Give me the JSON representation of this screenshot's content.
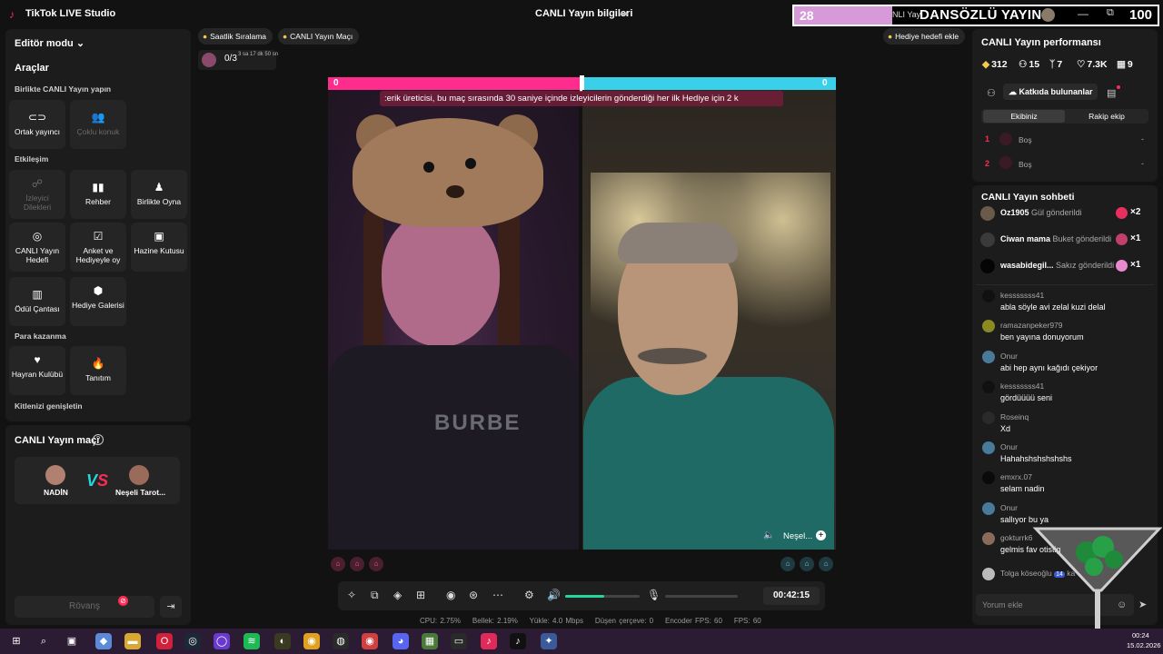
{
  "app": {
    "title": "TikTok LIVE Studio",
    "live_info": "CANLI Yayın bilgileri"
  },
  "overlay": {
    "left_count": "28",
    "middle_text": "NLI Yay",
    "title": "DANSÖZLÜ YAYIN",
    "right_count": "100"
  },
  "window_controls": {
    "minimize": "—",
    "maximize": "⧉"
  },
  "left_panel": {
    "editor_mode": "Editör modu",
    "tools_title": "Araçlar",
    "section_live_together": "Birlikte CANLI Yayın yapın",
    "section_interaction": "Etkileşim",
    "section_monetization": "Para kazanma",
    "section_expand": "Kitlenizi genişletin",
    "tiles_live_together": [
      {
        "label": "Ortak yayıncı",
        "icon": "link-icon",
        "enabled": true
      },
      {
        "label": "Çoklu konuk",
        "icon": "guests-icon",
        "enabled": false
      }
    ],
    "tiles_interaction": [
      {
        "label": "İzleyici Dilekleri",
        "icon": "viewer-wishes-icon",
        "enabled": false
      },
      {
        "label": "Rehber",
        "icon": "guide-icon",
        "enabled": true
      },
      {
        "label": "Birlikte Oyna",
        "icon": "play-together-icon",
        "enabled": true
      },
      {
        "label": "CANLI Yayın Hedefi",
        "icon": "goal-icon",
        "enabled": true
      },
      {
        "label": "Anket ve Hediyeyle oy",
        "icon": "poll-icon",
        "enabled": true
      },
      {
        "label": "Hazine Kutusu",
        "icon": "treasure-box-icon",
        "enabled": true
      },
      {
        "label": "Ödül Çantası",
        "icon": "reward-bag-icon",
        "enabled": true
      },
      {
        "label": "Hediye Galerisi",
        "icon": "gift-gallery-icon",
        "enabled": true
      }
    ],
    "tiles_monetization": [
      {
        "label": "Hayran Kulübü",
        "icon": "fan-club-icon",
        "enabled": true
      },
      {
        "label": "Tanıtım",
        "icon": "promote-icon",
        "enabled": true
      }
    ],
    "match_title": "CANLI Yayın maçı",
    "match_help": "?",
    "player1": "NADİN",
    "player2": "Neşeli Tarot...",
    "rematch": "Rövanş"
  },
  "center": {
    "chip_hourly": "Saatlik Sıralama",
    "chip_match": "CANLI Yayın Maçı",
    "chip_gift_goal": "Hediye hedefi ekle",
    "progress_count": "0/3",
    "progress_time": "3 sa 17 dk 50 sn",
    "score_left": "0",
    "score_right": "0",
    "ticker": ":erik üreticisi, bu maç sırasında 30 saniye içinde izleyicilerin gönderdiği her ilk Hediye için 2 k",
    "shirt_text": "BURBE",
    "opponent_short": "Neşel...",
    "timer": "00:42:15",
    "volume_percent": 52,
    "stats": {
      "cpu": "CPU:  2.75%",
      "memory": "Bellek:  2.19%",
      "upload": "Yükle:  4.0 Mbps",
      "dropped": "Düşen çerçeve:  0",
      "encoder_fps": "Encoder FPS:  60",
      "fps": "FPS:  60"
    }
  },
  "right_panel": {
    "perf_title": "CANLI Yayın performansı",
    "stats": [
      {
        "icon": "coin-icon",
        "value": "312"
      },
      {
        "icon": "viewers-icon",
        "value": "15"
      },
      {
        "icon": "followers-icon",
        "value": "7"
      },
      {
        "icon": "likes-icon",
        "value": "7.3K"
      },
      {
        "icon": "gift-box-icon",
        "value": "9"
      }
    ],
    "contributors_btn": "Katkıda bulunanlar",
    "tab_team": "Ekibiniz",
    "tab_rival": "Rakip ekip",
    "ranks": [
      {
        "num": "1",
        "name": "Boş",
        "val": "-"
      },
      {
        "num": "2",
        "name": "Boş",
        "val": "-"
      }
    ],
    "chat_title": "CANLI Yayın sohbeti",
    "gifts": [
      {
        "user": "Oz1905",
        "action": "Gül gönderildi",
        "count": "×2",
        "avatar_color": "#6a5a4a",
        "gift_color": "#e83060"
      },
      {
        "user": "Ciwan mama",
        "action": "Buket gönderildi",
        "count": "×1",
        "avatar_color": "#3a3a3a",
        "gift_color": "#c0406a"
      },
      {
        "user": "wasabidegil...",
        "action": "Sakız gönderildi",
        "count": "×1",
        "avatar_color": "#050505",
        "gift_color": "#e88ad0"
      }
    ],
    "messages": [
      {
        "user": "kesssssss41",
        "text": "abla söyle avi zelal kuzi delal",
        "avatar_color": "#111111"
      },
      {
        "user": "ramazanpeker979",
        "text": "ben yayına donuyorum",
        "avatar_color": "#8a8a20"
      },
      {
        "user": "Onur",
        "text": "abi hep aynı kağıdı çekiyor",
        "avatar_color": "#4a7a9a"
      },
      {
        "user": "kesssssss41",
        "text": "gördüüüü seni",
        "avatar_color": "#111111"
      },
      {
        "user": "Roseinq",
        "text": "Xd",
        "avatar_color": "#2a2a2a"
      },
      {
        "user": "Onur",
        "text": "Hahahshshshshshs",
        "avatar_color": "#4a7a9a"
      },
      {
        "user": "emxrx.07",
        "text": "selam nadin",
        "avatar_color": "#0a0a0a"
      },
      {
        "user": "Onur",
        "text": "sallıyor bu ya",
        "avatar_color": "#4a7a9a"
      },
      {
        "user": "gokturrk6",
        "text": "gelmis fav otistig",
        "avatar_color": "#8a6a5a"
      }
    ],
    "last_message": {
      "user": "Tolga köseoğlu",
      "badge": "14",
      "text": "ka"
    },
    "comment_placeholder": "Yorum ekle"
  },
  "taskbar": {
    "time": "00:24",
    "date": "15.02.2026",
    "apps": [
      {
        "name": "windows-start-icon",
        "color": "#2b1b33",
        "glyph": "⊞"
      },
      {
        "name": "search-icon",
        "color": "#2b1b33",
        "glyph": "⌕"
      },
      {
        "name": "task-view-icon",
        "color": "#2b1b33",
        "glyph": "▣"
      },
      {
        "name": "copilot-icon",
        "color": "#5a8ad8",
        "glyph": "◆"
      },
      {
        "name": "file-explorer-icon",
        "color": "#d8a830",
        "glyph": "▬"
      },
      {
        "name": "opera-icon",
        "color": "#d0203a",
        "glyph": "O"
      },
      {
        "name": "steam-icon",
        "color": "#1b2838",
        "glyph": "◎"
      },
      {
        "name": "app-purple-icon",
        "color": "#6a3ad0",
        "glyph": "◯"
      },
      {
        "name": "spotify-icon",
        "color": "#1db954",
        "glyph": "≋"
      },
      {
        "name": "app-dark-icon",
        "color": "#3a3a20",
        "glyph": "◐"
      },
      {
        "name": "chrome-icon",
        "color": "#e0a020",
        "glyph": "◉"
      },
      {
        "name": "app-circle-icon",
        "color": "#2a2a2a",
        "glyph": "◍"
      },
      {
        "name": "chrome-alt-icon",
        "color": "#d04040",
        "glyph": "◉"
      },
      {
        "name": "discord-icon",
        "color": "#5865f2",
        "glyph": "◕"
      },
      {
        "name": "photo-app-icon",
        "color": "#4a7a3a",
        "glyph": "▦"
      },
      {
        "name": "terminal-icon",
        "color": "#2a2a2a",
        "glyph": "▭"
      },
      {
        "name": "tiktok-live-icon",
        "color": "#e02a5a",
        "glyph": "♪"
      },
      {
        "name": "tiktok-icon",
        "color": "#111111",
        "glyph": "♪"
      },
      {
        "name": "network-app-icon",
        "color": "#3a5a9a",
        "glyph": "✦"
      }
    ]
  }
}
